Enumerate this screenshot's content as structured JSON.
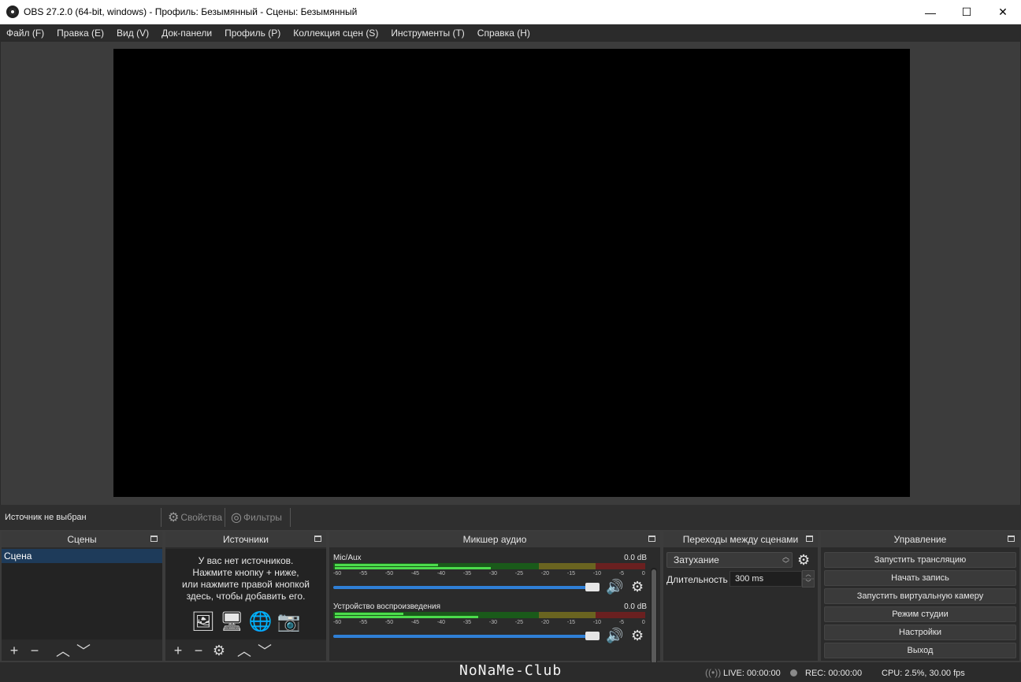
{
  "window": {
    "title": "OBS 27.2.0 (64-bit, windows) - Профиль: Безымянный - Сцены: Безымянный",
    "minimize": "—",
    "maximize": "☐",
    "close": "✕"
  },
  "menu": [
    "Файл (F)",
    "Правка (E)",
    "Вид (V)",
    "Док-панели",
    "Профиль (P)",
    "Коллекция сцен (S)",
    "Инструменты (T)",
    "Справка (H)"
  ],
  "source_toolbar": {
    "status": "Источник не выбран",
    "properties": "Свойства",
    "filters": "Фильтры"
  },
  "scenes": {
    "title": "Сцены",
    "items": [
      "Сцена"
    ]
  },
  "sources": {
    "title": "Источники",
    "empty_line1": "У вас нет источников.",
    "empty_line2": "Нажмите кнопку + ниже,",
    "empty_line3": "или нажмите правой кнопкой",
    "empty_line4": "здесь, чтобы добавить его."
  },
  "mixer": {
    "title": "Микшер аудио",
    "ticks": [
      "-60",
      "-55",
      "-50",
      "-45",
      "-40",
      "-35",
      "-30",
      "-25",
      "-20",
      "-15",
      "-10",
      "-5",
      "0"
    ],
    "channels": [
      {
        "name": "Mic/Aux",
        "db": "0.0 dB",
        "level": 0.33,
        "level2": 0.5
      },
      {
        "name": "Устройство воспроизведения",
        "db": "0.0 dB",
        "level": 0.22,
        "level2": 0.46
      }
    ]
  },
  "transitions": {
    "title": "Переходы между сценами",
    "selected": "Затухание",
    "duration_label": "Длительность",
    "duration_value": "300 ms"
  },
  "controls": {
    "title": "Управление",
    "start_stream": "Запустить трансляцию",
    "start_record": "Начать запись",
    "start_virtualcam": "Запустить виртуальную камеру",
    "studio_mode": "Режим студии",
    "settings": "Настройки",
    "exit": "Выход"
  },
  "status": {
    "watermark": "NoNaMe-Club",
    "live": "LIVE: 00:00:00",
    "rec": "REC: 00:00:00",
    "cpu": "CPU: 2.5%, 30.00 fps"
  }
}
